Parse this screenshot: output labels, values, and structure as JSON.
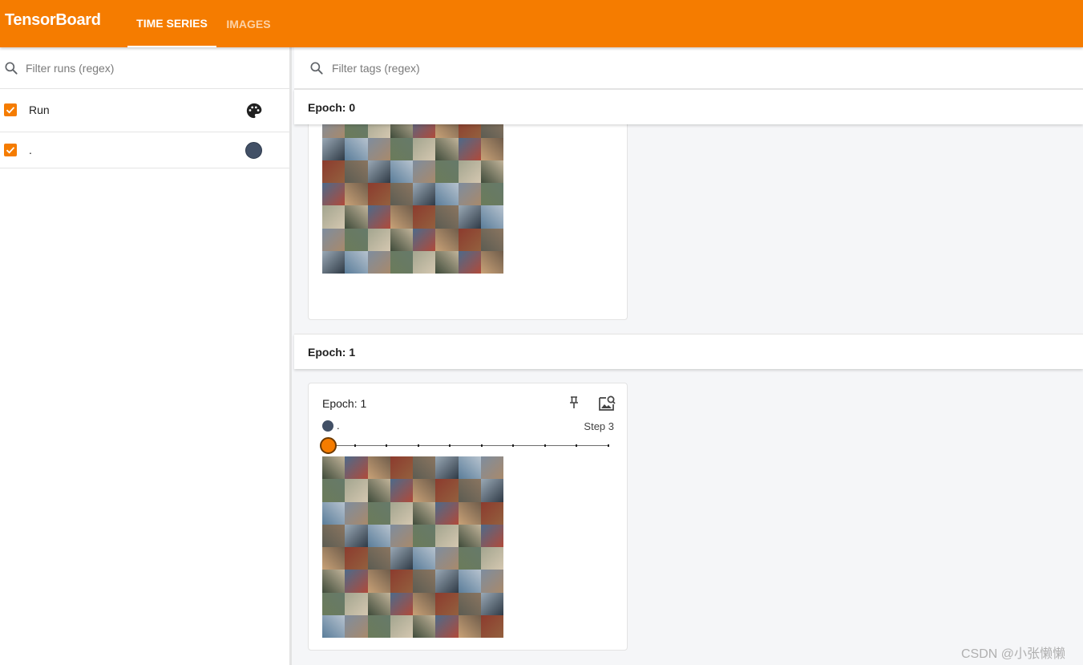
{
  "app": {
    "title": "TensorBoard",
    "tabs": [
      {
        "label": "TIME SERIES",
        "active": true
      },
      {
        "label": "IMAGES",
        "active": false
      }
    ],
    "accent_color": "#f57c00"
  },
  "sidebar": {
    "search_placeholder": "Filter runs (regex)",
    "header_label": "Run",
    "runs": [
      {
        "name": ".",
        "checked": true,
        "color": "#425066"
      }
    ]
  },
  "main": {
    "search_placeholder": "Filter tags (regex)",
    "groups": [
      {
        "title": "Epoch: 0",
        "card": {
          "title": "Epoch: 0",
          "grid_rows": 8,
          "grid_cols": 8
        }
      },
      {
        "title": "Epoch: 1",
        "card": {
          "title": "Epoch: 1",
          "run_name": ".",
          "step_label": "Step 3",
          "slider": {
            "current_index": 0,
            "tick_count": 10
          },
          "grid_rows": 8,
          "grid_cols": 8
        }
      }
    ]
  },
  "watermark": "CSDN @小张懒懒"
}
